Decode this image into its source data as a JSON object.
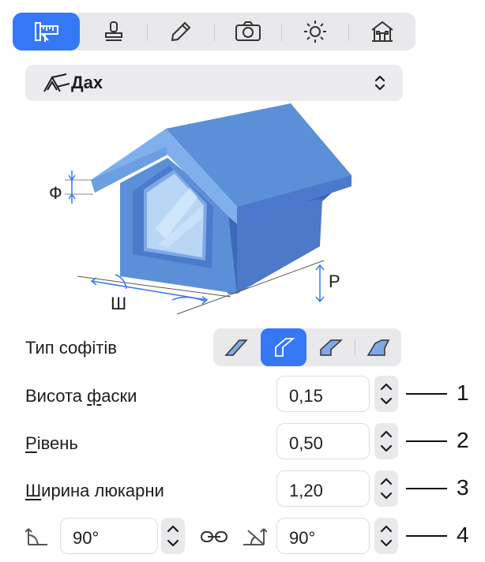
{
  "toolbar": {
    "items": [
      {
        "icon": "measure-ruler-icon",
        "active": true
      },
      {
        "icon": "stamp-icon",
        "active": false
      },
      {
        "icon": "pencil-icon",
        "active": false
      },
      {
        "icon": "camera-icon",
        "active": false
      },
      {
        "icon": "sun-icon",
        "active": false
      },
      {
        "icon": "house-icon",
        "active": false
      }
    ]
  },
  "dropdown": {
    "label": "Дах",
    "icon": "roof-icon",
    "chevron": "up-down-chevron-icon"
  },
  "diagram": {
    "label_f": "Ф",
    "label_sh": "Ш",
    "label_r": "Р"
  },
  "soffit": {
    "label": "Тип софітів",
    "options": [
      "soffit-type-1-icon",
      "soffit-type-2-icon",
      "soffit-type-3-icon",
      "soffit-type-4-icon"
    ],
    "selected_index": 1
  },
  "fields": {
    "chamfer": {
      "label": "Висота фаски",
      "underline_char": "ф",
      "value": "0,15"
    },
    "level": {
      "label": "Рівень",
      "underline_char": "Р",
      "value": "0,50"
    },
    "width": {
      "label": "Ширина люкарни",
      "underline_char": "Ш",
      "value": "1,20"
    },
    "angle_left": {
      "value": "90°"
    },
    "angle_right": {
      "value": "90°"
    }
  },
  "callouts": [
    "1",
    "2",
    "3",
    "4"
  ],
  "colors": {
    "accent": "#3478f6",
    "roof": "#5b8fd8"
  }
}
